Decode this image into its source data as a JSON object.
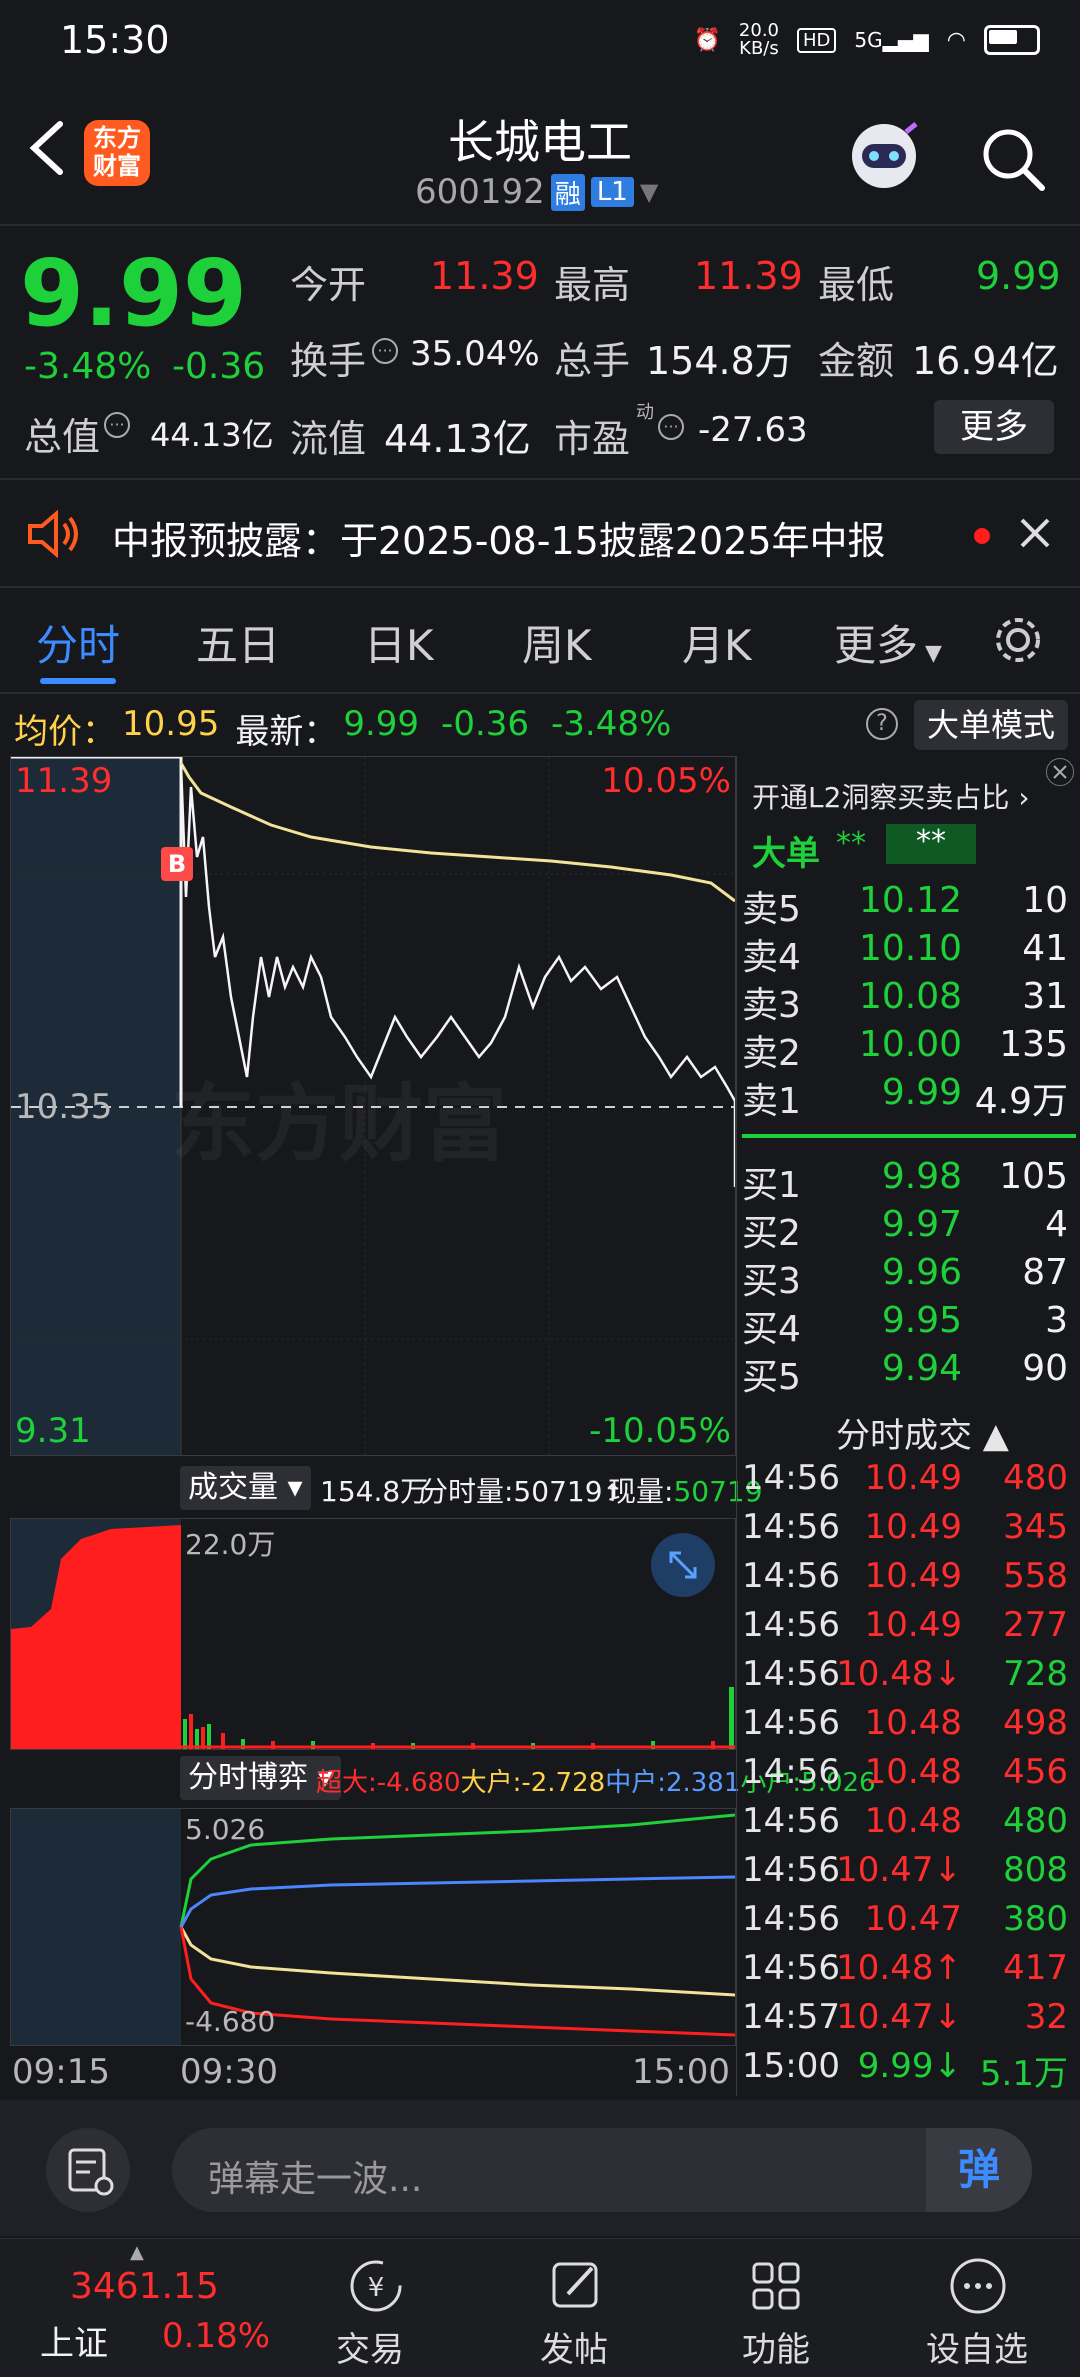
{
  "status_bar": {
    "time": "15:30",
    "net_speed": "20.0\nKB/s",
    "hd": "HD",
    "signal": "5G"
  },
  "header": {
    "title": "长城电工",
    "code": "600192",
    "badge_rong": "融",
    "badge_level": "L1",
    "logo_text": "东方\n财富"
  },
  "quote": {
    "price": "9.99",
    "change_pct": "-3.48%",
    "change": "-0.36",
    "open_label": "今开",
    "open": "11.39",
    "high_label": "最高",
    "high": "11.39",
    "low_label": "最低",
    "low": "9.99",
    "turnover_label": "换手",
    "turnover": "35.04%",
    "volume_label": "总手",
    "volume": "154.8万",
    "amount_label": "金额",
    "amount": "16.94亿",
    "mktcap_label": "总值",
    "mktcap": "44.13亿",
    "float_label": "流值",
    "float": "44.13亿",
    "pe_label": "市盈",
    "pe_sup": "动",
    "pe": "-27.63",
    "more_button": "更多"
  },
  "notice": {
    "text": "中报预披露：于2025-08-15披露2025年中报"
  },
  "tabs": [
    "分时",
    "五日",
    "日K",
    "周K",
    "月K",
    "更多"
  ],
  "chart_info": {
    "avg_label": "均价：",
    "avg": "10.95",
    "last_label": "最新：",
    "last": "9.99",
    "chg": "-0.36",
    "chg_pct": "-3.48%",
    "big_order_mode": "大单模式",
    "max_price": "11.39",
    "max_pct": "10.05%",
    "mid_price": "10.35",
    "min_price": "9.31",
    "min_pct": "-10.05%",
    "b_marker": "B",
    "watermark": "东方财富"
  },
  "volume_panel": {
    "selector": "成交量",
    "total": "154.8万",
    "tick_label": "分时量:50719",
    "now_label": "现量:",
    "now": "50719",
    "max": "22.0万"
  },
  "game_panel": {
    "selector": "分时博弈",
    "super_label": "超大:",
    "super": "-4.680",
    "big_label": "大户:",
    "big": "-2.728",
    "mid_label": "中户:",
    "mid": "2.381",
    "small_label": "小户:",
    "small": "5.026",
    "top": "5.026",
    "bottom": "-4.680"
  },
  "time_axis": [
    "09:15",
    "09:30",
    "15:00"
  ],
  "l2_promo": "开通L2洞察买卖占比",
  "big_order": {
    "label": "大单",
    "v1": "**",
    "v2": "**"
  },
  "order_book": {
    "asks": [
      {
        "label": "卖5",
        "price": "10.12",
        "vol": "10"
      },
      {
        "label": "卖4",
        "price": "10.10",
        "vol": "41"
      },
      {
        "label": "卖3",
        "price": "10.08",
        "vol": "31"
      },
      {
        "label": "卖2",
        "price": "10.00",
        "vol": "135"
      },
      {
        "label": "卖1",
        "price": "9.99",
        "vol": "4.9万"
      }
    ],
    "bids": [
      {
        "label": "买1",
        "price": "9.98",
        "vol": "105"
      },
      {
        "label": "买2",
        "price": "9.97",
        "vol": "4"
      },
      {
        "label": "买3",
        "price": "9.96",
        "vol": "87"
      },
      {
        "label": "买4",
        "price": "9.95",
        "vol": "3"
      },
      {
        "label": "买5",
        "price": "9.94",
        "vol": "90"
      }
    ]
  },
  "trades_header": "分时成交",
  "trades": [
    {
      "time": "14:56",
      "price": "10.49",
      "vol": "480",
      "pc": "#ff2d2d",
      "vc": "#ff2d2d"
    },
    {
      "time": "14:56",
      "price": "10.49",
      "vol": "345",
      "pc": "#ff2d2d",
      "vc": "#ff2d2d"
    },
    {
      "time": "14:56",
      "price": "10.49",
      "vol": "558",
      "pc": "#ff2d2d",
      "vc": "#ff2d2d"
    },
    {
      "time": "14:56",
      "price": "10.49",
      "vol": "277",
      "pc": "#ff2d2d",
      "vc": "#ff2d2d"
    },
    {
      "time": "14:56",
      "price": "10.48↓",
      "vol": "728",
      "pc": "#ff2d2d",
      "vc": "#1ed13a"
    },
    {
      "time": "14:56",
      "price": "10.48",
      "vol": "498",
      "pc": "#ff2d2d",
      "vc": "#ff2d2d"
    },
    {
      "time": "14:56",
      "price": "10.48",
      "vol": "456",
      "pc": "#ff2d2d",
      "vc": "#ff2d2d"
    },
    {
      "time": "14:56",
      "price": "10.48",
      "vol": "480",
      "pc": "#ff2d2d",
      "vc": "#1ed13a"
    },
    {
      "time": "14:56",
      "price": "10.47↓",
      "vol": "808",
      "pc": "#ff2d2d",
      "vc": "#1ed13a"
    },
    {
      "time": "14:56",
      "price": "10.47",
      "vol": "380",
      "pc": "#ff2d2d",
      "vc": "#1ed13a"
    },
    {
      "time": "14:56",
      "price": "10.48↑",
      "vol": "417",
      "pc": "#ff2d2d",
      "vc": "#ff2d2d"
    },
    {
      "time": "14:57",
      "price": "10.47↓",
      "vol": "32",
      "pc": "#ff2d2d",
      "vc": "#ff2d2d"
    },
    {
      "time": "15:00",
      "price": "9.99↓",
      "vol": "5.1万",
      "pc": "#1ed13a",
      "vc": "#1ed13a"
    }
  ],
  "danmu": {
    "placeholder": "弹幕走一波...",
    "button": "弹"
  },
  "bottom_nav": {
    "index_value": "3461.15",
    "index_name": "上证",
    "index_pct": "0.18%",
    "items": [
      "交易",
      "发帖",
      "功能",
      "设自选"
    ]
  },
  "colors": {
    "up": "#ff2d2d",
    "down": "#1ed13a",
    "accent": "#3c8cff",
    "bg": "#17181c"
  }
}
